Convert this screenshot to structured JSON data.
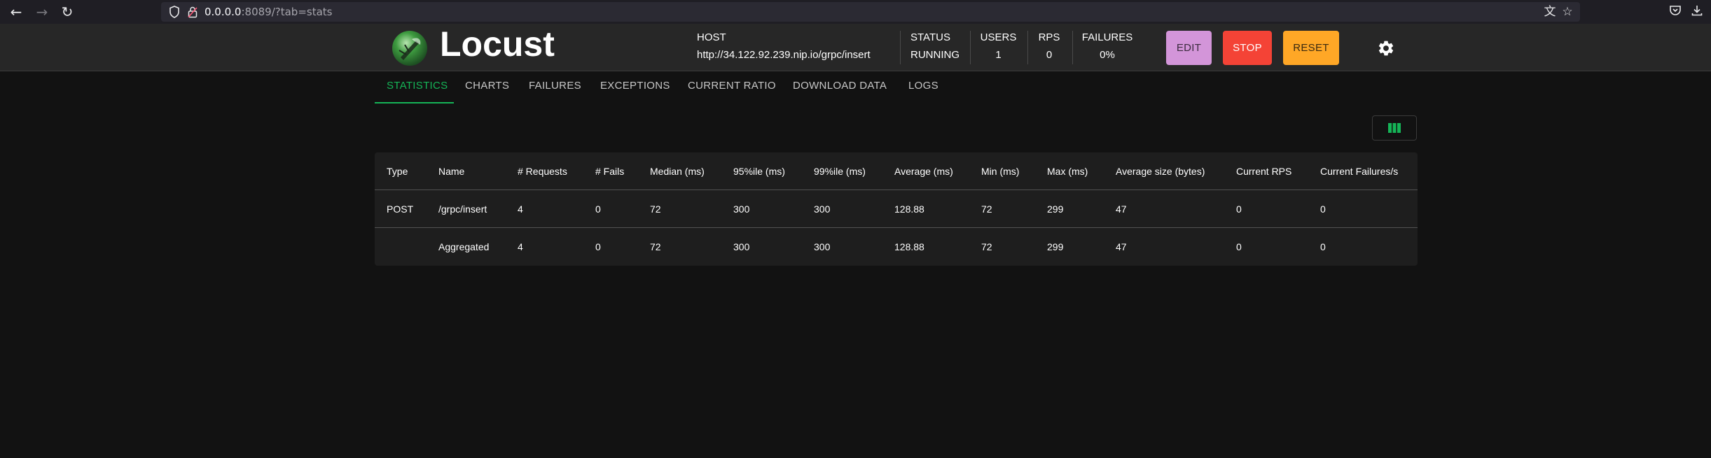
{
  "browser": {
    "url_host": "0.0.0.0",
    "url_rest": ":8089/?tab=stats"
  },
  "app": {
    "name": "Locust",
    "host_label": "HOST",
    "host_value": "http://34.122.92.239.nip.io/grpc/insert",
    "status_label": "STATUS",
    "status_value": "RUNNING",
    "users_label": "USERS",
    "users_value": "1",
    "rps_label": "RPS",
    "rps_value": "0",
    "failures_label": "FAILURES",
    "failures_value": "0%",
    "edit_label": "EDIT",
    "stop_label": "STOP",
    "reset_label": "RESET",
    "colors": {
      "edit": "#d395d9",
      "stop": "#f44336",
      "reset": "#ffa726",
      "accent": "#15b457"
    }
  },
  "tabs": [
    {
      "label": "STATISTICS",
      "active": true
    },
    {
      "label": "CHARTS"
    },
    {
      "label": "FAILURES"
    },
    {
      "label": "EXCEPTIONS"
    },
    {
      "label": "CURRENT RATIO"
    },
    {
      "label": "DOWNLOAD DATA"
    },
    {
      "label": "LOGS"
    }
  ],
  "table": {
    "headers": [
      "Type",
      "Name",
      "# Requests",
      "# Fails",
      "Median (ms)",
      "95%ile (ms)",
      "99%ile (ms)",
      "Average (ms)",
      "Min (ms)",
      "Max (ms)",
      "Average size (bytes)",
      "Current RPS",
      "Current Failures/s"
    ],
    "rows": [
      [
        "POST",
        "/grpc/insert",
        "4",
        "0",
        "72",
        "300",
        "300",
        "128.88",
        "72",
        "299",
        "47",
        "0",
        "0"
      ],
      [
        "",
        "Aggregated",
        "4",
        "0",
        "72",
        "300",
        "300",
        "128.88",
        "72",
        "299",
        "47",
        "0",
        "0"
      ]
    ]
  },
  "icons": {
    "back": "back-arrow-icon",
    "forward": "forward-arrow-icon",
    "reload": "reload-icon",
    "shield": "shield-icon",
    "lock": "insecure-lock-icon",
    "translate": "translate-icon",
    "bookmark": "star-icon",
    "pocket": "pocket-icon",
    "downloads": "download-icon",
    "settings": "gear-icon",
    "columns": "columns-icon"
  }
}
